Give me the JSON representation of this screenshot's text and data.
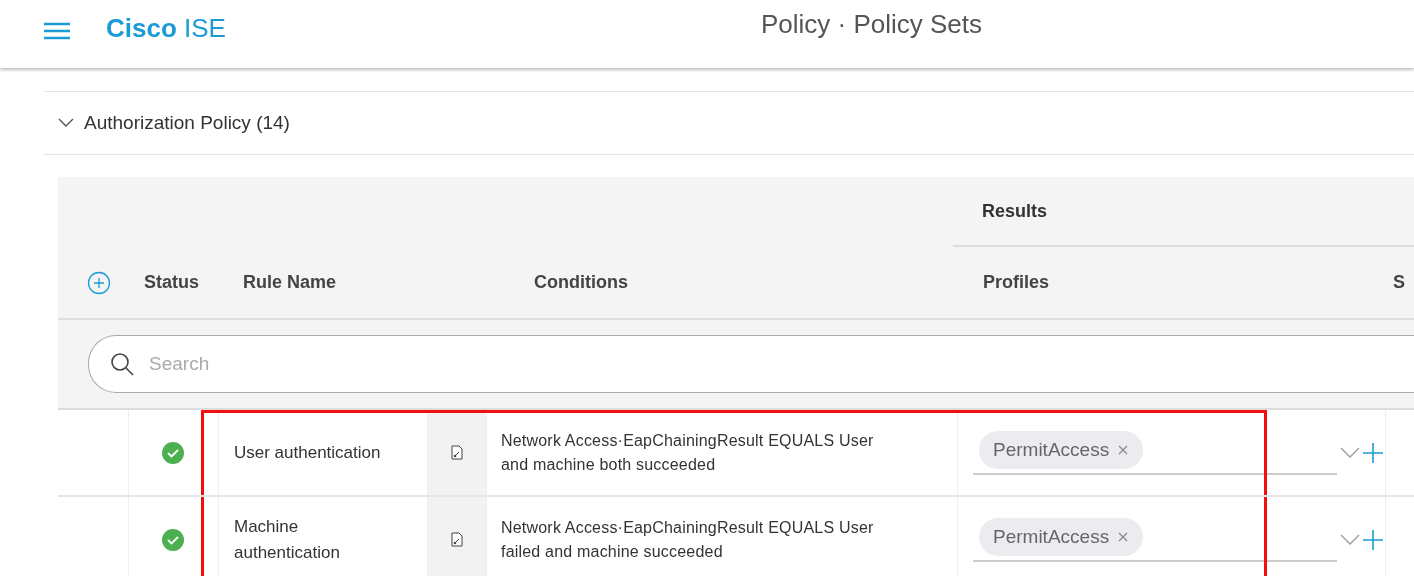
{
  "header": {
    "brand_bold": "Cisco",
    "brand_light": "ISE",
    "title": "Policy · Policy Sets"
  },
  "section": {
    "title": "Authorization Policy (14)",
    "expanded": true
  },
  "table": {
    "group_header": "Results",
    "columns": [
      "Status",
      "Rule Name",
      "Conditions",
      "Profiles",
      "S"
    ],
    "search": {
      "placeholder": "Search"
    },
    "rows": [
      {
        "enabled": true,
        "name": "User authentication",
        "condition": "Network Access·EapChainingResult EQUALS User and machine both succeeded",
        "profile": "PermitAccess",
        "highlighted": true
      },
      {
        "enabled": true,
        "name": "Machine authentication",
        "condition": "Network Access·EapChainingResult EQUALS User failed and machine succeeded",
        "profile": "PermitAccess",
        "highlighted": true
      }
    ]
  }
}
